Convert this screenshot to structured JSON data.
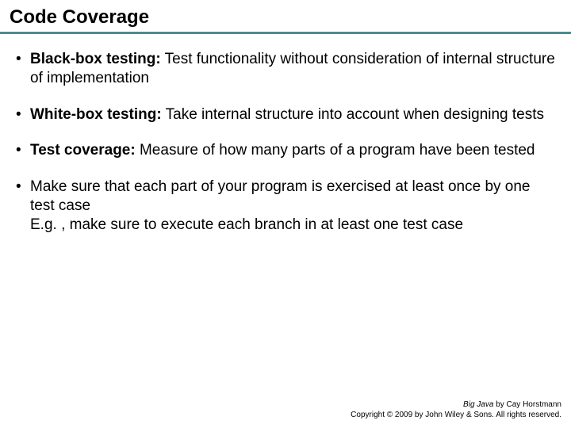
{
  "title": "Code Coverage",
  "bullets": [
    {
      "term": "Black-box testing:",
      "desc": " Test functionality without consideration of internal structure of implementation"
    },
    {
      "term": "White-box testing:",
      "desc": " Take internal structure into account when designing tests"
    },
    {
      "term": "Test coverage:",
      "desc": " Measure of how many parts of a program have been tested"
    },
    {
      "term": "",
      "desc": "Make sure that each part of your program is exercised at least once by one test case",
      "extra": "E.g. , make sure to execute each branch in at least one test case"
    }
  ],
  "footer": {
    "book": "Big Java",
    "author": " by Cay Horstmann",
    "copyright": "Copyright © 2009 by John Wiley & Sons.  All rights reserved."
  }
}
